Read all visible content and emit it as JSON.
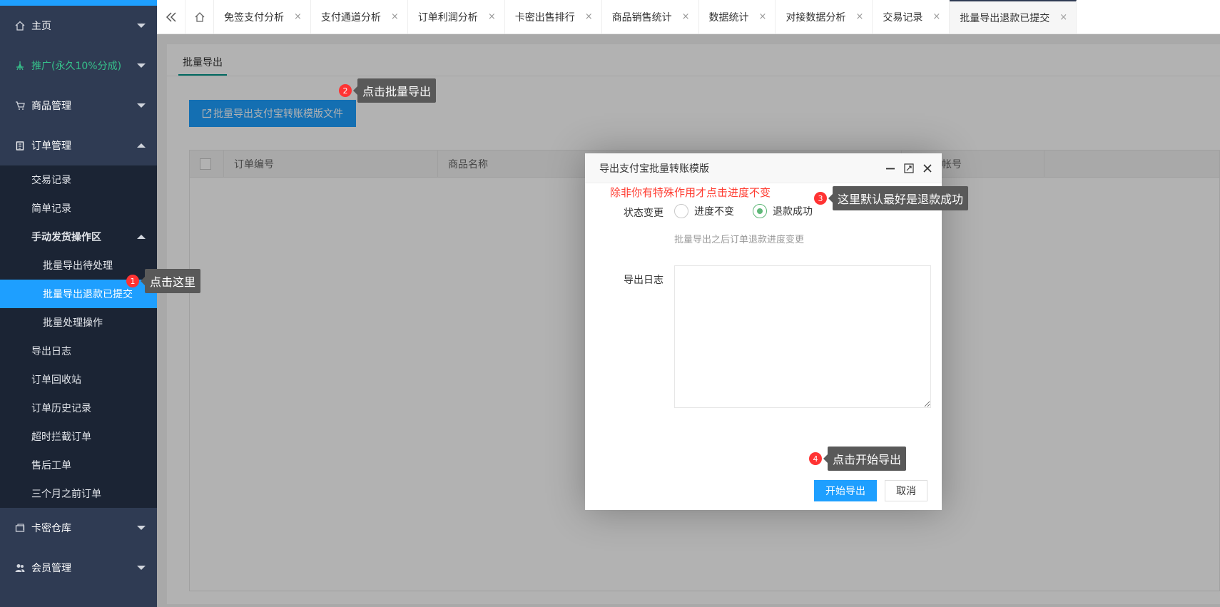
{
  "sidebar": {
    "items": [
      {
        "label": "主页",
        "icon": "home-icon"
      },
      {
        "label": "推广(永久10%分成)",
        "icon": "promo-icon"
      },
      {
        "label": "商品管理",
        "icon": "cart-icon"
      },
      {
        "label": "订单管理",
        "icon": "clipboard-icon"
      },
      {
        "label": "卡密仓库",
        "icon": "warehouse-icon"
      },
      {
        "label": "会员管理",
        "icon": "users-icon"
      }
    ],
    "order_sub": [
      "交易记录",
      "简单记录",
      "手动发货操作区",
      "批量导出待处理",
      "批量导出退款已提交",
      "批量处理操作",
      "导出日志",
      "订单回收站",
      "订单历史记录",
      "超时拦截订单",
      "售后工单",
      "三个月之前订单"
    ]
  },
  "tabs": [
    "免签支付分析",
    "支付通道分析",
    "订单利润分析",
    "卡密出售排行",
    "商品销售统计",
    "数据统计",
    "对接数据分析",
    "交易记录",
    "批量导出退款已提交"
  ],
  "tab_close": "×",
  "main": {
    "subtab": "批量导出",
    "export_button": "批量导出支付宝转账模版文件",
    "columns": [
      "订单编号",
      "商品名称",
      "支付宝帐号"
    ]
  },
  "dialog": {
    "title": "导出支付宝批量转账模版",
    "warning": "除非你有特殊作用才点击进度不变",
    "status_label": "状态变更",
    "option_unchanged": "进度不变",
    "option_refunded": "退款成功",
    "hint": "批量导出之后订单退款进度变更",
    "log_label": "导出日志",
    "start_button": "开始导出",
    "cancel_button": "取消"
  },
  "callouts": [
    {
      "num": "1",
      "text": "点击这里"
    },
    {
      "num": "2",
      "text": "点击批量导出"
    },
    {
      "num": "3",
      "text": "这里默认最好是退款成功"
    },
    {
      "num": "4",
      "text": "点击开始导出"
    }
  ],
  "colors": {
    "sidebar_bg": "#2f3b53",
    "accent_blue": "#1e9fff",
    "warning_red": "#ff3b30",
    "radio_green": "#5fb878",
    "promo_green": "#36c08a"
  }
}
